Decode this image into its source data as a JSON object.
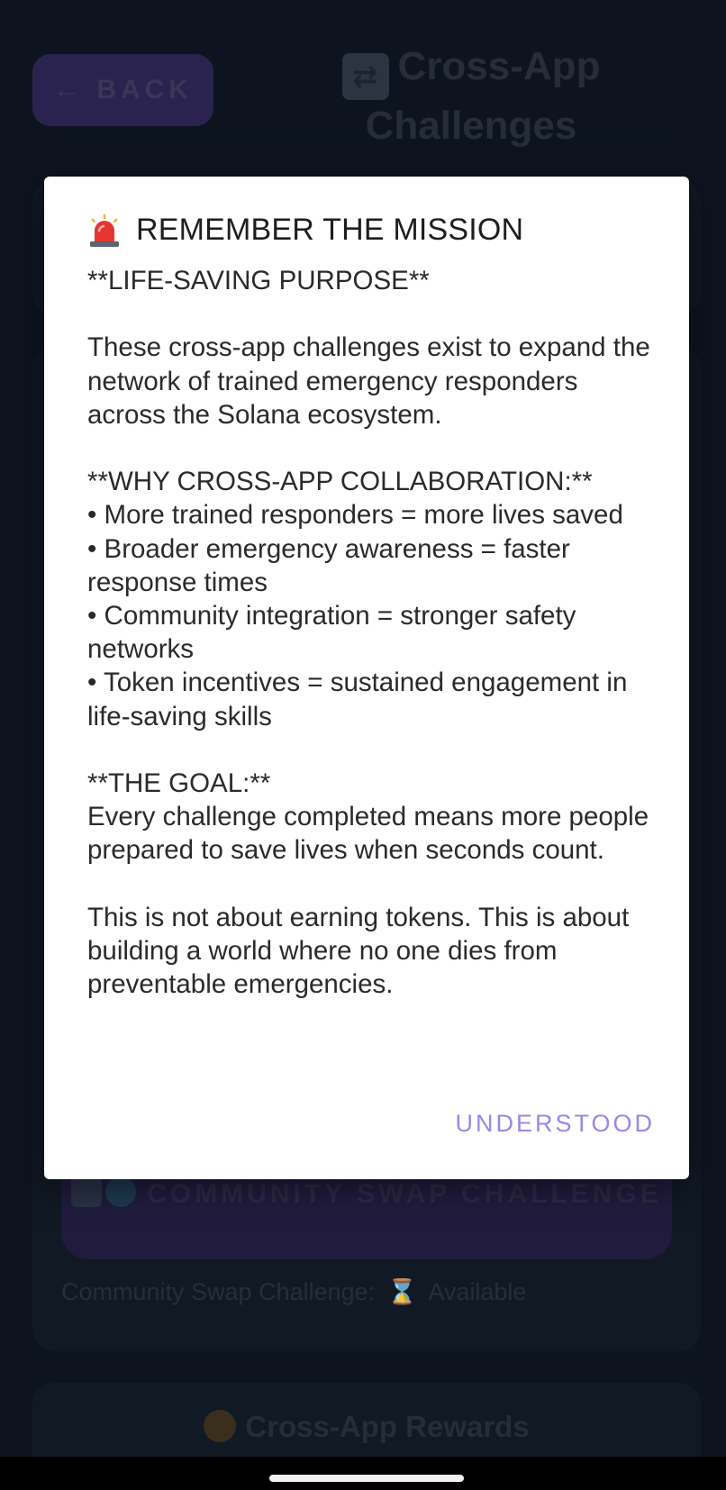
{
  "background": {
    "back_label": "← BACK",
    "page_title": "Cross-App Challenges",
    "swap_button_label": "COMMUNITY SWAP CHALLENGE",
    "swap_status_label": "Community Swap Challenge:",
    "swap_status_value": "Available",
    "rewards_title": "Cross-App Rewards"
  },
  "dialog": {
    "title": "REMEMBER THE MISSION",
    "title_icon": "siren-icon",
    "paragraphs": [
      "**LIFE-SAVING PURPOSE**",
      "These cross-app challenges exist to expand the network of trained emergency responders across the Solana ecosystem.",
      "**WHY CROSS-APP COLLABORATION:**\n• More trained responders = more lives saved\n• Broader emergency awareness = faster response times\n• Community integration = stronger safety networks\n• Token incentives = sustained engagement in life-saving skills",
      "**THE GOAL:**\nEvery challenge completed means more people prepared to save lives when seconds count.",
      "This is not about earning tokens. This is about building a world where no one dies from preventable emergencies."
    ],
    "confirm_label": "UNDERSTOOD"
  },
  "colors": {
    "accent": "#9b87e6",
    "background": "#0d1420",
    "dialog_bg": "#ffffff"
  }
}
